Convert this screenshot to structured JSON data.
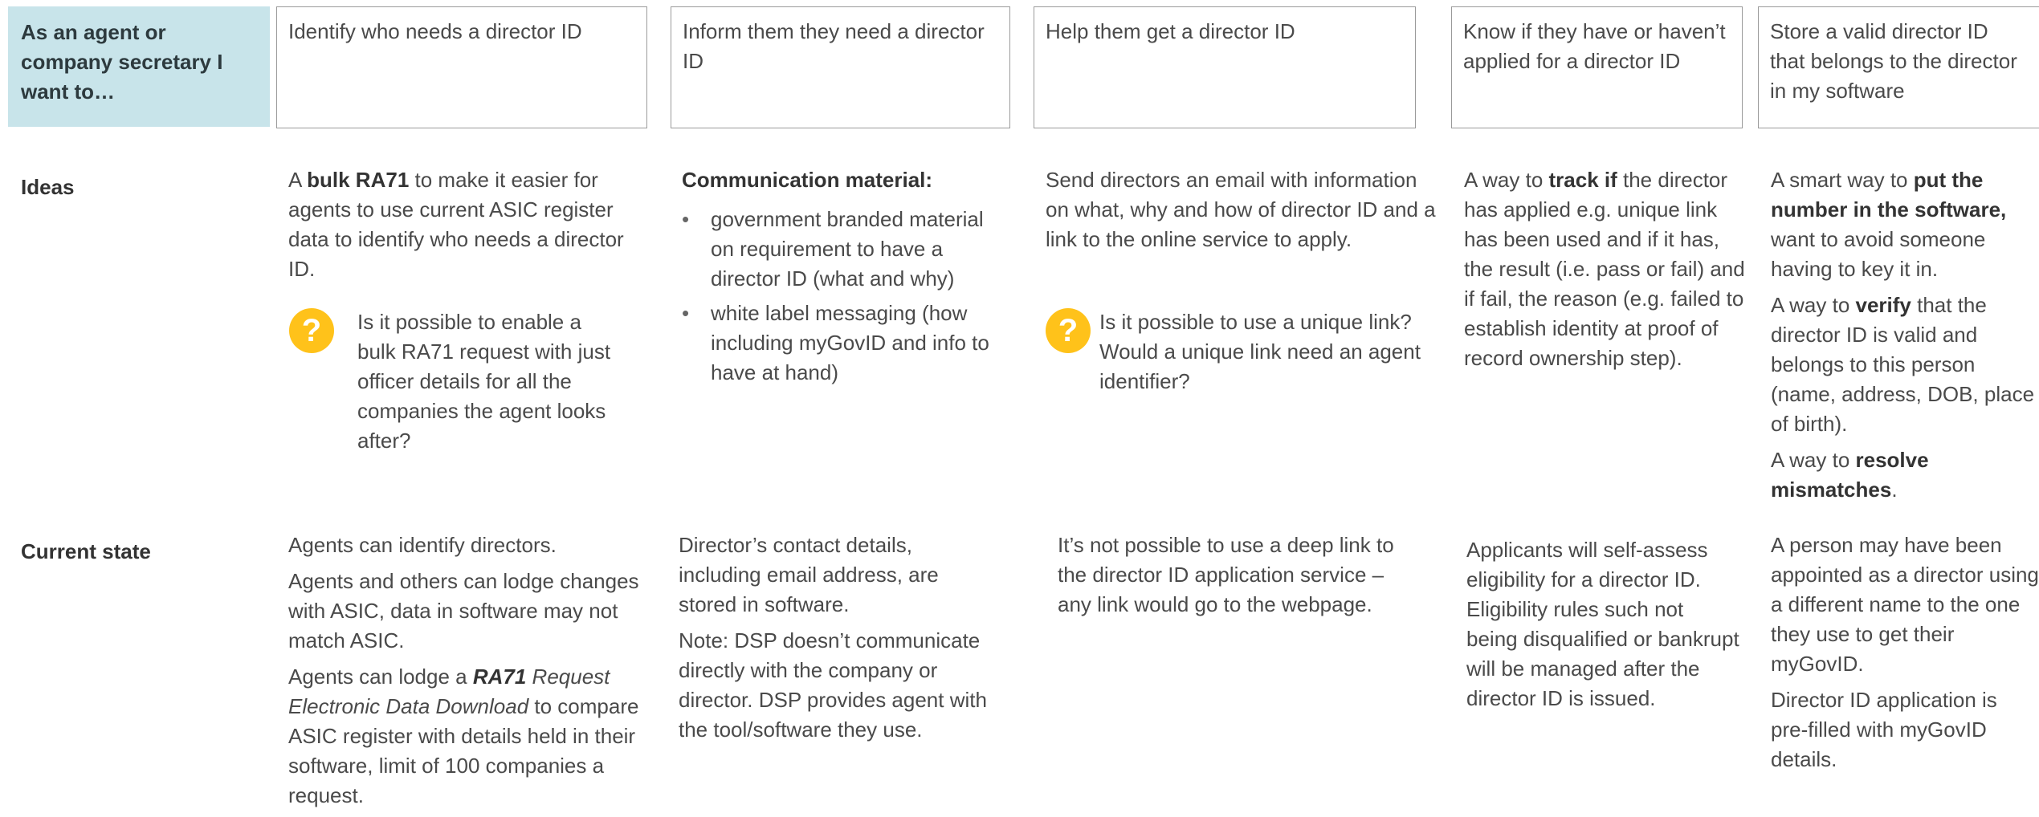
{
  "header": {
    "label": "As an agent or company secretary I want to…",
    "columns": [
      "Identify who needs a director ID",
      "Inform them they need a director ID",
      "Help them get a director ID",
      "Know if they have or haven’t applied for a director ID",
      "Store a valid director ID that belongs to the director in my software"
    ]
  },
  "rows": {
    "ideas_label": "Ideas",
    "current_label": "Current state"
  },
  "ideas": {
    "col1": {
      "text_a": "A ",
      "bold": "bulk RA71",
      "text_b": " to make it easier for agents to use current ASIC register data to identify who needs a director ID.",
      "question": "Is it possible to enable a bulk RA71 request  with just officer details for all the companies the agent looks after?"
    },
    "col2": {
      "heading": "Communication material:",
      "bullets": [
        "government branded material on requirement to have a director ID (what and why)",
        "white label messaging (how including myGovID and info to have at  hand)"
      ]
    },
    "col3": {
      "text": "Send directors an email with information on what, why and how of director ID and a link to the online service to apply.",
      "question": "Is it possible to use a unique link? Would a unique link need an agent identifier?"
    },
    "col4": {
      "text_a": "A way to ",
      "bold": "track if",
      "text_b": " the director has applied e.g. unique link has been used and if it has, the result (i.e. pass or fail) and if fail, the reason (e.g. failed to establish identity at proof of record ownership step)."
    },
    "col5": {
      "p1_a": "A smart way to ",
      "p1_bold": "put the number in the software,",
      "p1_b": " want to avoid someone having to key it in.",
      "p2_a": "A way to ",
      "p2_bold": "verify",
      "p2_b": " that the director ID is valid and belongs to this person (name, address, DOB, place of birth).",
      "p3_a": "A way to ",
      "p3_bold": "resolve mismatches",
      "p3_b": "."
    }
  },
  "current": {
    "col1": {
      "p1": "Agents can identify directors.",
      "p2": "Agents and others can lodge changes with ASIC, data in software may not match ASIC.",
      "p3_a": "Agents can lodge a ",
      "p3_bolditalic": "RA71",
      "p3_italic": " Request Electronic Data Download",
      "p3_b": " to compare ASIC register with details held in their software, limit of 100 companies a request."
    },
    "col2": {
      "p1": "Director’s contact details, including email address, are stored in software.",
      "p2": "Note: DSP doesn’t communicate directly with the company or director. DSP provides agent with the tool/software they use."
    },
    "col3": {
      "p1": "It’s not possible to use a deep link to the director ID application service – any link would go to the webpage."
    },
    "col4": {
      "p1": "Applicants will self-assess eligibility for a director ID. Eligibility rules such not being  disqualified or bankrupt will be managed after the director ID is issued."
    },
    "col5": {
      "p1": "A person may have been appointed as a director using a different name to the one they use to get their myGovID.",
      "p2": "Director ID application is pre-filled with myGovID details."
    }
  },
  "icons": {
    "question": "?"
  },
  "colors": {
    "header_fill": "#c8e4ea",
    "question_icon": "#ffc21a"
  }
}
